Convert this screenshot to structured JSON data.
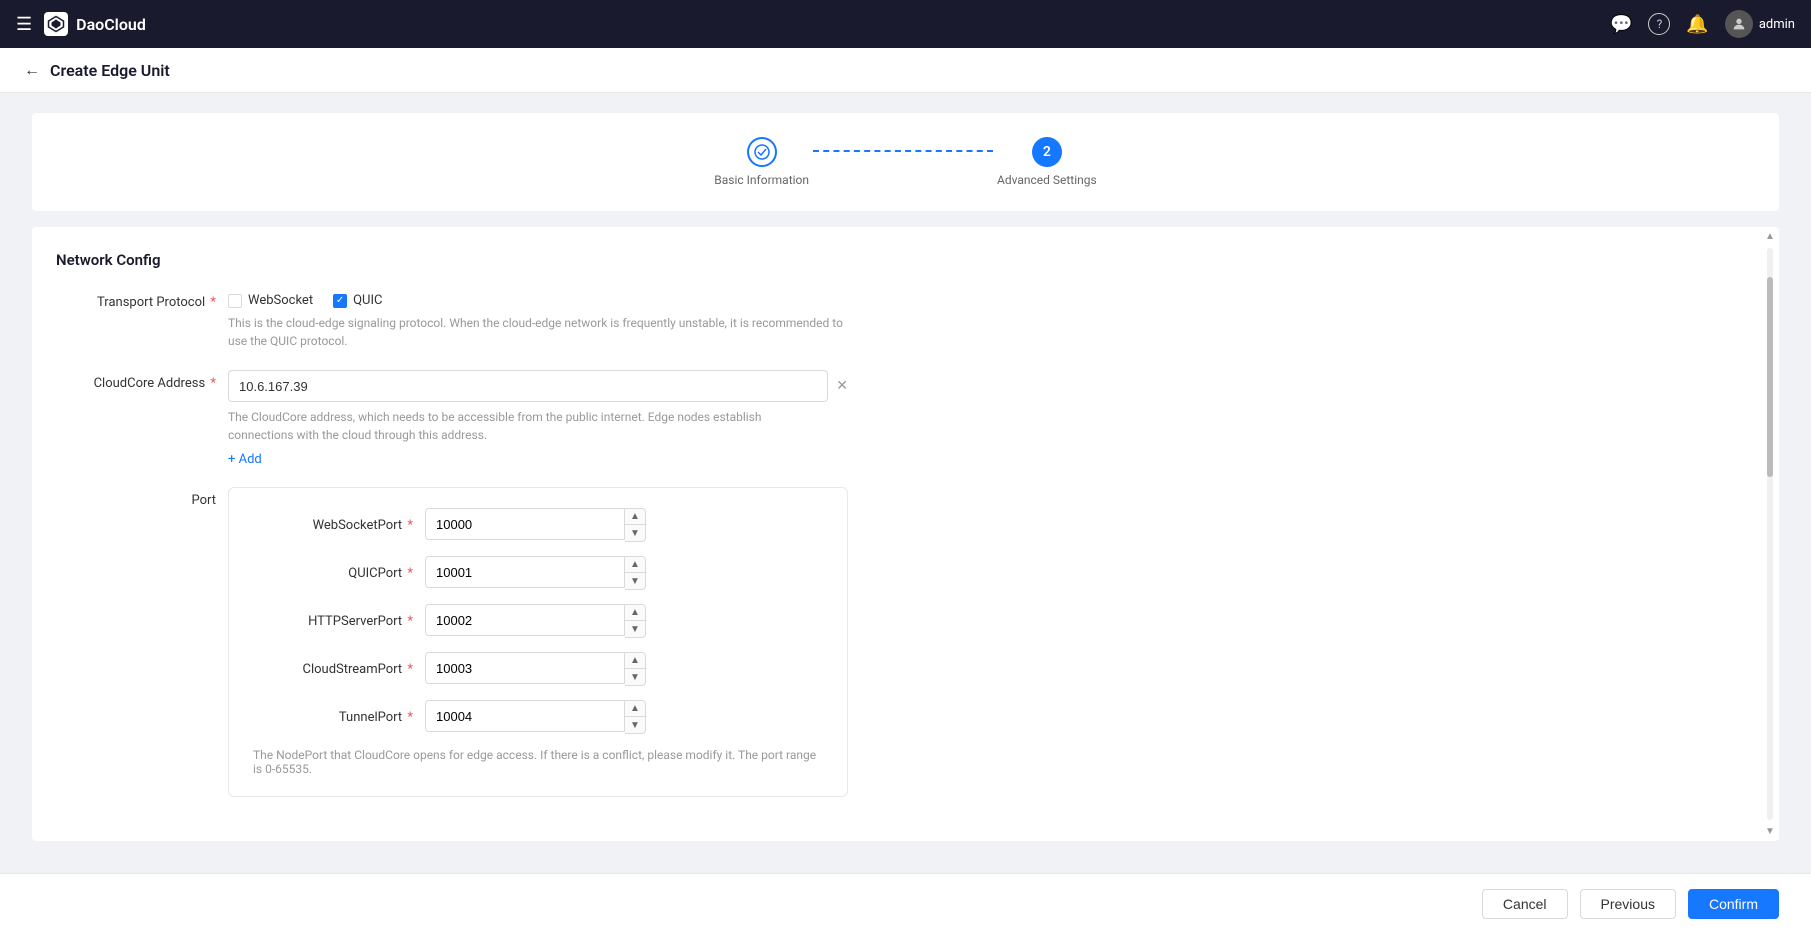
{
  "topnav": {
    "logo_text": "DaoCloud",
    "username": "admin"
  },
  "page": {
    "title": "Create Edge Unit",
    "back_label": "←"
  },
  "stepper": {
    "step1": {
      "label": "Basic Information",
      "state": "completed",
      "number": "1"
    },
    "step2": {
      "label": "Advanced Settings",
      "state": "active",
      "number": "2"
    }
  },
  "network_config": {
    "section_title": "Network Config",
    "transport_protocol": {
      "label": "Transport Protocol",
      "websocket_label": "WebSocket",
      "quic_label": "QUIC",
      "websocket_checked": false,
      "quic_checked": true,
      "hint": "This is the cloud-edge signaling protocol. When the cloud-edge network is frequently unstable, it is recommended to use the QUIC protocol."
    },
    "cloudcore_address": {
      "label": "CloudCore Address",
      "value": "10.6.167.39",
      "hint1": "The CloudCore address, which needs to be accessible from the public internet. Edge nodes establish",
      "hint2": "connections with the cloud through this address.",
      "add_label": "+ Add"
    },
    "port": {
      "label": "Port",
      "websocket_port_label": "WebSocketPort",
      "websocket_port_value": "10000",
      "quic_port_label": "QUICPort",
      "quic_port_value": "10001",
      "http_server_port_label": "HTTPServerPort",
      "http_server_port_value": "10002",
      "cloud_stream_port_label": "CloudStreamPort",
      "cloud_stream_port_value": "10003",
      "tunnel_port_label": "TunnelPort",
      "tunnel_port_value": "10004",
      "port_hint": "The NodePort that CloudCore opens for edge access. If there is a conflict, please modify it. The port range is 0-65535."
    }
  },
  "footer": {
    "cancel_label": "Cancel",
    "previous_label": "Previous",
    "confirm_label": "Confirm"
  },
  "icons": {
    "hamburger": "☰",
    "chat": "💬",
    "help": "?",
    "bell": "🔔",
    "user": "👤",
    "check": "✓",
    "plus": "+",
    "times": "×"
  }
}
